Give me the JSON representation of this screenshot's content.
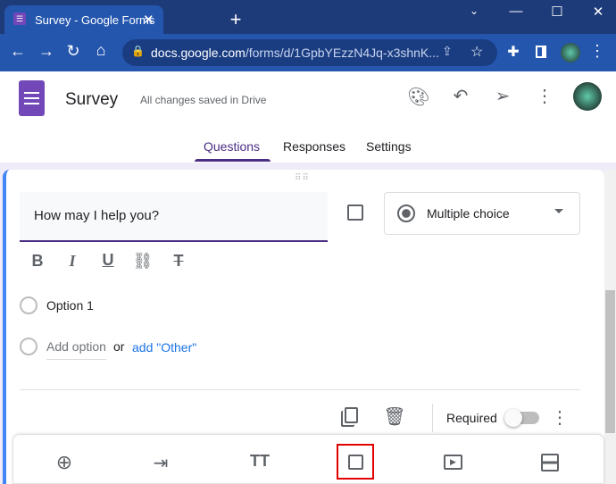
{
  "browser": {
    "tab_title": "Survey - Google Forms",
    "url_domain": "docs.google.com",
    "url_path": "/forms/d/1GpbYEzzN4Jq-x3shnK..."
  },
  "header": {
    "title": "Survey",
    "save_status": "All changes saved in Drive"
  },
  "tabs": [
    {
      "label": "Questions",
      "active": true
    },
    {
      "label": "Responses"
    },
    {
      "label": "Settings"
    }
  ],
  "question": {
    "title": "How may I help you?",
    "type": "Multiple choice",
    "options": [
      "Option 1"
    ],
    "add_option": "Add option",
    "or": "or",
    "add_other": "add \"Other\"",
    "required_label": "Required",
    "required": false
  },
  "colors": {
    "accent": "#673ab7",
    "chrome": "#2556ae",
    "link": "#1a73e8",
    "highlight": "#e00000"
  }
}
